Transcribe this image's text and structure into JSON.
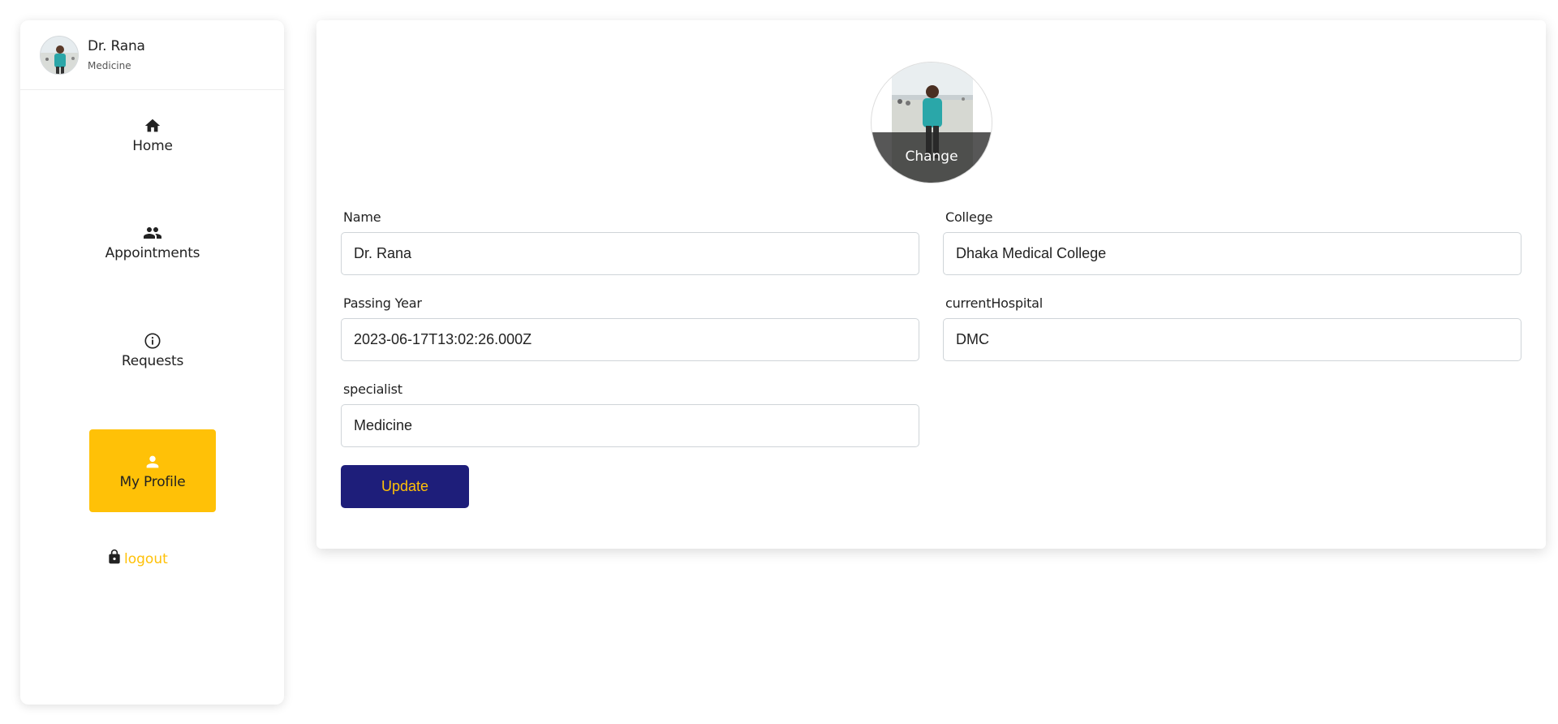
{
  "user": {
    "name": "Dr. Rana",
    "department": "Medicine"
  },
  "sidebar": {
    "items": [
      {
        "label": "Home",
        "icon": "home-icon"
      },
      {
        "label": "Appointments",
        "icon": "people-icon"
      },
      {
        "label": "Requests",
        "icon": "info-icon"
      },
      {
        "label": "My Profile",
        "icon": "person-icon",
        "active": true
      }
    ],
    "logout_label": "logout"
  },
  "profile": {
    "change_label": "Change",
    "fields": {
      "name": {
        "label": "Name",
        "value": "Dr. Rana"
      },
      "college": {
        "label": "College",
        "value": "Dhaka Medical College"
      },
      "passing_year": {
        "label": "Passing Year",
        "value": "2023-06-17T13:02:26.000Z"
      },
      "current_hospital": {
        "label": "currentHospital",
        "value": "DMC"
      },
      "specialist": {
        "label": "specialist",
        "value": "Medicine"
      }
    },
    "update_label": "Update"
  },
  "colors": {
    "accent": "#ffc107",
    "primary_button": "#1e1e7a"
  }
}
